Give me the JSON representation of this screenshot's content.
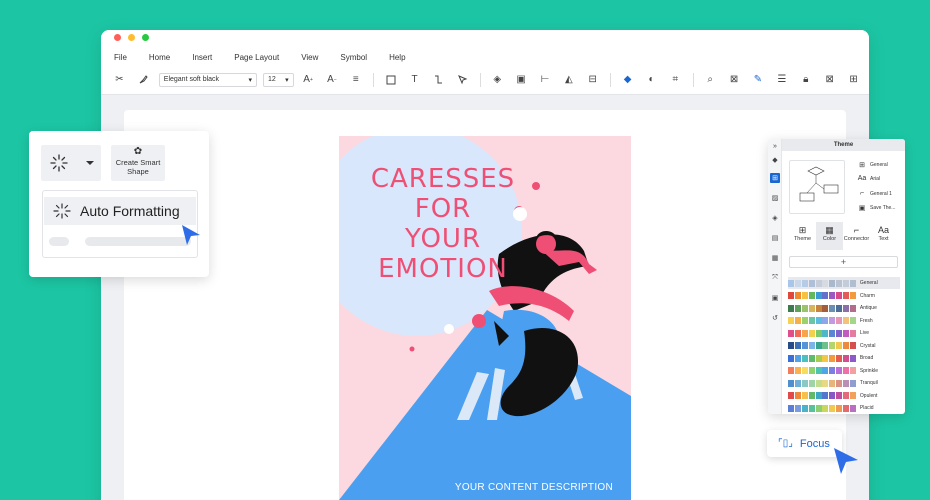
{
  "window": {
    "dots": [
      "#ff5f57",
      "#febc2e",
      "#28c840"
    ]
  },
  "menu": [
    "File",
    "Home",
    "Insert",
    "Page Layout",
    "View",
    "Symbol",
    "Help"
  ],
  "toolbar": {
    "font_name": "Elegant soft black",
    "font_size": "12"
  },
  "poster": {
    "title_lines": [
      "CARESSES",
      "FOR",
      "YOUR",
      "EMOTION"
    ],
    "footer": "YOUR CONTENT DESCRIPTION",
    "colors": {
      "background": "#fcd9e0",
      "circle": "#d8e7fb",
      "road": "#4a9ff0",
      "title": "#ef4f74"
    }
  },
  "left_panel": {
    "smart_shape_label": "Create Smart Shape",
    "auto_formatting_label": "Auto Formatting"
  },
  "right_panel": {
    "header": "Theme",
    "options": [
      {
        "icon": "general-icon",
        "label": "General"
      },
      {
        "icon": "font-icon",
        "label": "Arial"
      },
      {
        "icon": "connector-icon",
        "label": "General 1"
      },
      {
        "icon": "save-icon",
        "label": "Save The..."
      }
    ],
    "tabs": [
      "Theme",
      "Color",
      "Connector",
      "Text"
    ],
    "add_label": "+",
    "palettes": [
      {
        "name": "General",
        "colors": [
          "#a9c6e8",
          "#c9d7ea",
          "#b6cbe6",
          "#aebfd7",
          "#c6cdd8",
          "#d6dbe3",
          "#aab8cc",
          "#b9c3d2",
          "#c3ccd9",
          "#b0bed0"
        ]
      },
      {
        "name": "Charm",
        "colors": [
          "#e0473b",
          "#f08a30",
          "#f5c242",
          "#62b85a",
          "#3c9bd6",
          "#6470c9",
          "#9b58c2",
          "#d9498a",
          "#e25b5b",
          "#f19a3e"
        ]
      },
      {
        "name": "Antique",
        "colors": [
          "#3d7a4e",
          "#5fa05c",
          "#9cc26a",
          "#d7b55a",
          "#c7833f",
          "#a35d3a",
          "#6b8fb3",
          "#4e6e9a",
          "#8a6fa8",
          "#b46c8b"
        ]
      },
      {
        "name": "Fresh",
        "colors": [
          "#f6d154",
          "#f4b04b",
          "#9bd26c",
          "#69c5a4",
          "#5bbbe0",
          "#8fa6e8",
          "#c39ae0",
          "#e896b8",
          "#f3c27a",
          "#a4d68a"
        ]
      },
      {
        "name": "Live",
        "colors": [
          "#e04e8b",
          "#f06b5a",
          "#f6a54a",
          "#f2d24c",
          "#7bc96f",
          "#4fb7c9",
          "#5a86d6",
          "#8564c9",
          "#c05cbd",
          "#e67ba0"
        ]
      },
      {
        "name": "Crystal",
        "colors": [
          "#274b86",
          "#3d6fb4",
          "#5694d8",
          "#7bb4e8",
          "#3aa48f",
          "#6cc08a",
          "#b4d56c",
          "#f0c94e",
          "#ea8b3f",
          "#d45050"
        ]
      },
      {
        "name": "Broad",
        "colors": [
          "#3a6fd8",
          "#52a3e6",
          "#4cc0c0",
          "#5dbb6b",
          "#a6cc52",
          "#f2c744",
          "#f39a3c",
          "#e75b4e",
          "#cf4f8f",
          "#8d5ac9"
        ]
      },
      {
        "name": "Sprinkle",
        "colors": [
          "#f57c5a",
          "#f9b24f",
          "#f8dc5c",
          "#8fd270",
          "#4cc4b0",
          "#4fa6e6",
          "#7c7fe0",
          "#bc6fd8",
          "#ef6fa8",
          "#f5a0a0"
        ]
      },
      {
        "name": "Tranquil",
        "colors": [
          "#4f8fcf",
          "#6fb0d8",
          "#88c9c6",
          "#9fd3a8",
          "#c3dc8e",
          "#e6d884",
          "#e9b47c",
          "#d99386",
          "#b98fb5",
          "#8f9dd0"
        ]
      },
      {
        "name": "Opulent",
        "colors": [
          "#e04a4a",
          "#f0883c",
          "#f5c14a",
          "#63b96a",
          "#3ea7c8",
          "#5476cf",
          "#8758c5",
          "#c04e9e",
          "#e36a7c",
          "#f2a15a"
        ]
      },
      {
        "name": "Placid",
        "colors": [
          "#5b7fd6",
          "#7b9be0",
          "#4ab3c8",
          "#56c19a",
          "#8ccf6e",
          "#c9d85c",
          "#f2c851",
          "#f09a4e",
          "#e46b6b",
          "#b86fc4"
        ]
      }
    ]
  },
  "focus_button": {
    "label": "Focus"
  }
}
